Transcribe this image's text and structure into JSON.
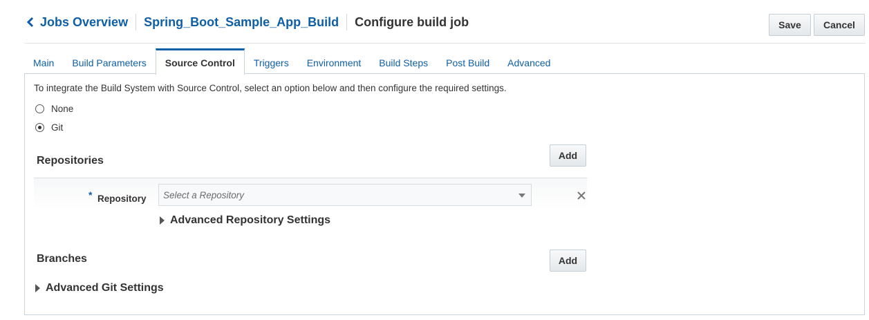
{
  "header": {
    "back_link": "Jobs Overview",
    "job_link": "Spring_Boot_Sample_App_Build",
    "title": "Configure build job",
    "save_label": "Save",
    "cancel_label": "Cancel"
  },
  "tabs": [
    {
      "label": "Main",
      "active": false
    },
    {
      "label": "Build Parameters",
      "active": false
    },
    {
      "label": "Source Control",
      "active": true
    },
    {
      "label": "Triggers",
      "active": false
    },
    {
      "label": "Environment",
      "active": false
    },
    {
      "label": "Build Steps",
      "active": false
    },
    {
      "label": "Post Build",
      "active": false
    },
    {
      "label": "Advanced",
      "active": false
    }
  ],
  "source_control": {
    "intro": "To integrate the Build System with Source Control, select an option below and then configure the required settings.",
    "options": [
      {
        "label": "None",
        "selected": false
      },
      {
        "label": "Git",
        "selected": true
      }
    ],
    "repositories": {
      "title": "Repositories",
      "add_label": "Add",
      "repository_label": "Repository",
      "required_mark": "*",
      "select_placeholder": "Select a Repository",
      "advanced_label": "Advanced Repository Settings"
    },
    "branches": {
      "title": "Branches",
      "add_label": "Add"
    },
    "advanced_git_label": "Advanced Git Settings"
  },
  "colors": {
    "link_blue": "#0f5fa6",
    "text": "#333333",
    "border": "#c9d3db"
  },
  "icons": {
    "back": "chevron-left-icon",
    "remove": "close-icon",
    "dropdown": "caret-down-icon",
    "expand": "triangle-right-icon"
  }
}
